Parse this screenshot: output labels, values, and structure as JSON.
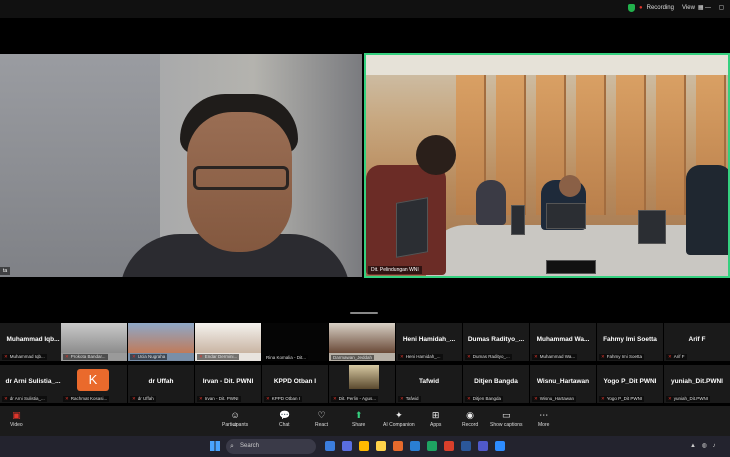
{
  "topbar": {
    "recording_label": "Recording",
    "view_label": "View",
    "window_controls": "— ▢"
  },
  "main": {
    "left_video_name": "ta",
    "right_video_name": "Dit. Pelindungan WNI"
  },
  "gallery": {
    "row1": [
      {
        "big": "Muhammad Iqb...",
        "small": "Muhammad Iqb..."
      },
      {
        "big": "",
        "small": "Prokota Bandar..."
      },
      {
        "big": "",
        "small": "Ucia Nugraha"
      },
      {
        "big": "",
        "small": "Endar Dermini..."
      },
      {
        "big": "",
        "small": "Rina Komalia - Dit..."
      },
      {
        "big": "",
        "small": "Darmawan_Jeddah"
      },
      {
        "big": "Heni Hamidah_...",
        "small": "Heni Hamidah_..."
      },
      {
        "big": "Dumas Radityo_...",
        "small": "Dumas Radityo_..."
      },
      {
        "big": "Muhammad Wa...",
        "small": "Muhammad Wa..."
      },
      {
        "big": "Fahmy Imi Soetta",
        "small": "Fahmy Imi Soetta"
      },
      {
        "big": "Arif F",
        "small": "Arif F"
      }
    ],
    "row2": [
      {
        "big": "dr Arni Sulistia_...",
        "small": "dr Arni Sulistia_..."
      },
      {
        "big": "K",
        "small": "Rachmat Kosasi..."
      },
      {
        "big": "dr Uffah",
        "small": "dr Uffah"
      },
      {
        "big": "Irvan - Dit. PWNI",
        "small": "Irvan - Dit. PWNI"
      },
      {
        "big": "KPPD Otban I",
        "small": "KPPD Otban I"
      },
      {
        "big": "",
        "small": "Dit. Perlin - Agus..."
      },
      {
        "big": "Tafwid",
        "small": "Tafwid"
      },
      {
        "big": "Ditjen Bangda",
        "small": "Ditjen Bangda"
      },
      {
        "big": "Wisnu_Hartawan",
        "small": "Wisnu_Hartawan"
      },
      {
        "big": "Yogo P_Dit PWNI",
        "small": "Yogo P_Dit PWNI"
      },
      {
        "big": "yuniah_Dit.PWNI",
        "small": "yuniah_Dit.PWNI"
      }
    ]
  },
  "toolbar": {
    "video": "Video",
    "participants": "Participants",
    "participant_count": "47",
    "chat": "Chat",
    "react": "React",
    "share": "Share",
    "ai_companion": "AI Companion",
    "apps": "Apps",
    "record": "Record",
    "show_captions": "Show captions",
    "more": "More"
  },
  "taskbar": {
    "search_label": "Search"
  },
  "colors": {
    "active_speaker_border": "#35d07f",
    "record_red": "#e0352b",
    "avatar_k": "#ea6a2c"
  }
}
